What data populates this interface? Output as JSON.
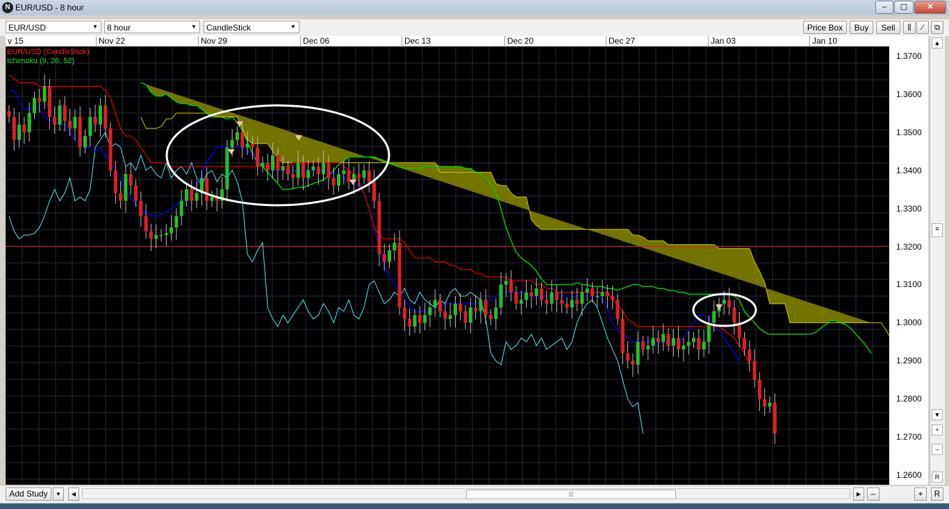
{
  "window": {
    "title": "EUR/USD - 8 hour",
    "minimize": "–",
    "maximize": "▢",
    "close": "✕"
  },
  "toolbar": {
    "symbol": "EUR/USD",
    "timeframe": "8 hour",
    "chart_type": "CandleStick",
    "price_box": "Price Box",
    "buy": "Buy",
    "sell": "Sell"
  },
  "legend": {
    "series1": "EUR/USD (CandleStick)",
    "series2": "Ichimoku (9, 26, 52)",
    "series1_color": "#ff2020",
    "series2_color": "#22dd22"
  },
  "bottom": {
    "add_study": "Add Study",
    "scroll_r": "R",
    "plus": "+",
    "minus": "–"
  },
  "colors": {
    "background": "#000000",
    "grid": "#2a2a3a",
    "bull": "#22c322",
    "bear": "#e02020",
    "tenkan": "#0000ff",
    "kijun": "#dd0000",
    "chikou": "#5fe6f0",
    "cloud": "#808000",
    "reference_line": "#cc2222"
  },
  "chart_data": {
    "type": "candlestick",
    "symbol": "EUR/USD",
    "interval": "8 hour",
    "x_tick_labels": [
      "v 15",
      "Nov 22",
      "Nov 29",
      "Dec 06",
      "Dec 13",
      "Dec 20",
      "Dec 27",
      "Jan 03",
      "Jan 10"
    ],
    "y_tick_labels": [
      "1.3700",
      "1.3600",
      "1.3500",
      "1.3400",
      "1.3300",
      "1.3200",
      "1.3100",
      "1.3000",
      "1.2900",
      "1.2800",
      "1.2700",
      "1.2600"
    ],
    "ylim": [
      1.2575,
      1.3725
    ],
    "reference_line": 1.32,
    "grid": true,
    "legend_position": "top-left",
    "x_start": "Nov 15",
    "x_end": "Jan 16",
    "close": [
      1.354,
      1.348,
      1.352,
      1.35,
      1.355,
      1.359,
      1.358,
      1.362,
      1.354,
      1.352,
      1.357,
      1.353,
      1.351,
      1.354,
      1.346,
      1.349,
      1.354,
      1.352,
      1.357,
      1.351,
      1.34,
      1.334,
      1.332,
      1.339,
      1.336,
      1.332,
      1.328,
      1.324,
      1.322,
      1.323,
      1.323,
      1.3235,
      1.325,
      1.328,
      1.332,
      1.335,
      1.332,
      1.334,
      1.338,
      1.332,
      1.333,
      1.332,
      1.335,
      1.346,
      1.348,
      1.35,
      1.346,
      1.347,
      1.346,
      1.341,
      1.342,
      1.34,
      1.344,
      1.34,
      1.341,
      1.339,
      1.338,
      1.342,
      1.338,
      1.34,
      1.341,
      1.339,
      1.342,
      1.338,
      1.336,
      1.339,
      1.34,
      1.337,
      1.339,
      1.338,
      1.34,
      1.337,
      1.332,
      1.318,
      1.316,
      1.319,
      1.321,
      1.304,
      1.301,
      1.299,
      1.302,
      1.3,
      1.302,
      1.304,
      1.306,
      1.303,
      1.301,
      1.302,
      1.305,
      1.303,
      1.3,
      1.304,
      1.303,
      1.306,
      1.302,
      1.301,
      1.304,
      1.31,
      1.311,
      1.308,
      1.305,
      1.306,
      1.308,
      1.307,
      1.309,
      1.306,
      1.305,
      1.308,
      1.306,
      1.305,
      1.304,
      1.306,
      1.305,
      1.308,
      1.309,
      1.307,
      1.307,
      1.308,
      1.307,
      1.306,
      1.301,
      1.292,
      1.29,
      1.289,
      1.295,
      1.293,
      1.294,
      1.296,
      1.295,
      1.297,
      1.294,
      1.296,
      1.293,
      1.294,
      1.295,
      1.296,
      1.293,
      1.295,
      1.3,
      1.303,
      1.305,
      1.306,
      1.304,
      1.3,
      1.296,
      1.293,
      1.29,
      1.285,
      1.28,
      1.278,
      1.279,
      1.271
    ],
    "ichimoku": {
      "params": [
        9,
        26,
        52
      ],
      "tenkan": [
        1.361,
        1.361,
        1.358,
        1.356,
        1.356,
        1.357,
        1.356,
        1.354,
        1.353,
        1.353,
        1.352,
        1.352,
        1.35,
        1.348,
        1.347,
        1.346,
        1.346,
        1.345,
        1.346,
        1.344,
        1.342,
        1.34,
        1.338,
        1.335,
        1.333,
        1.331,
        1.33,
        1.329,
        1.328,
        1.328,
        1.3285,
        1.329,
        1.33,
        1.331,
        1.332,
        1.333,
        1.334,
        1.336,
        1.339,
        1.342,
        1.344,
        1.346,
        1.346,
        1.346,
        1.346,
        1.346,
        1.346,
        1.345,
        1.344,
        1.343,
        1.342,
        1.341,
        1.34,
        1.34,
        1.34,
        1.34,
        1.34,
        1.34,
        1.34,
        1.34,
        1.34,
        1.34,
        1.34,
        1.34,
        1.339,
        1.339,
        1.338,
        1.338,
        1.337,
        1.336,
        1.334,
        1.33,
        1.325,
        1.32,
        1.315,
        1.312,
        1.31,
        1.308,
        1.306,
        1.304,
        1.303,
        1.303,
        1.303,
        1.303,
        1.304,
        1.304,
        1.305,
        1.305,
        1.305,
        1.305,
        1.305,
        1.305,
        1.305,
        1.305,
        1.305,
        1.306,
        1.307,
        1.308,
        1.308,
        1.308,
        1.308,
        1.308,
        1.307,
        1.307,
        1.307,
        1.307,
        1.307,
        1.307,
        1.307,
        1.307,
        1.307,
        1.307,
        1.307,
        1.307,
        1.307,
        1.307,
        1.307,
        1.306,
        1.304,
        1.3,
        1.298,
        1.297,
        1.296,
        1.295,
        1.295,
        1.295,
        1.295,
        1.295,
        1.295,
        1.295,
        1.295,
        1.295,
        1.295,
        1.296,
        1.298,
        1.3,
        1.302,
        1.302,
        1.301,
        1.3,
        1.298,
        1.296,
        1.294,
        1.292,
        1.29
      ],
      "kijun": [
        1.365,
        1.364,
        1.363,
        1.363,
        1.363,
        1.363,
        1.362,
        1.362,
        1.362,
        1.362,
        1.362,
        1.362,
        1.362,
        1.362,
        1.362,
        1.362,
        1.362,
        1.362,
        1.362,
        1.361,
        1.359,
        1.355,
        1.351,
        1.349,
        1.349,
        1.348,
        1.346,
        1.344,
        1.342,
        1.342,
        1.342,
        1.342,
        1.341,
        1.341,
        1.341,
        1.341,
        1.341,
        1.341,
        1.341,
        1.341,
        1.341,
        1.341,
        1.341,
        1.341,
        1.341,
        1.341,
        1.341,
        1.341,
        1.341,
        1.341,
        1.341,
        1.341,
        1.341,
        1.341,
        1.341,
        1.341,
        1.342,
        1.342,
        1.342,
        1.342,
        1.342,
        1.342,
        1.342,
        1.342,
        1.342,
        1.342,
        1.341,
        1.34,
        1.339,
        1.337,
        1.334,
        1.33,
        1.325,
        1.323,
        1.322,
        1.322,
        1.322,
        1.322,
        1.321,
        1.319,
        1.317,
        1.317,
        1.317,
        1.317,
        1.316,
        1.316,
        1.316,
        1.315,
        1.315,
        1.314,
        1.314,
        1.314,
        1.313,
        1.313,
        1.312,
        1.312,
        1.312,
        1.312,
        1.312,
        1.311,
        1.311,
        1.311,
        1.311,
        1.311,
        1.31,
        1.31,
        1.309,
        1.309,
        1.308,
        1.308,
        1.308,
        1.308,
        1.308,
        1.308,
        1.308,
        1.308,
        1.308,
        1.308,
        1.308,
        1.306,
        1.305,
        1.303,
        1.301,
        1.3,
        1.299,
        1.299,
        1.299,
        1.299,
        1.299,
        1.299,
        1.299,
        1.299,
        1.299,
        1.299,
        1.299,
        1.299,
        1.299,
        1.299,
        1.299,
        1.299,
        1.299,
        1.298,
        1.297,
        1.296,
        1.294,
        1.292,
        1.289
      ]
    }
  }
}
